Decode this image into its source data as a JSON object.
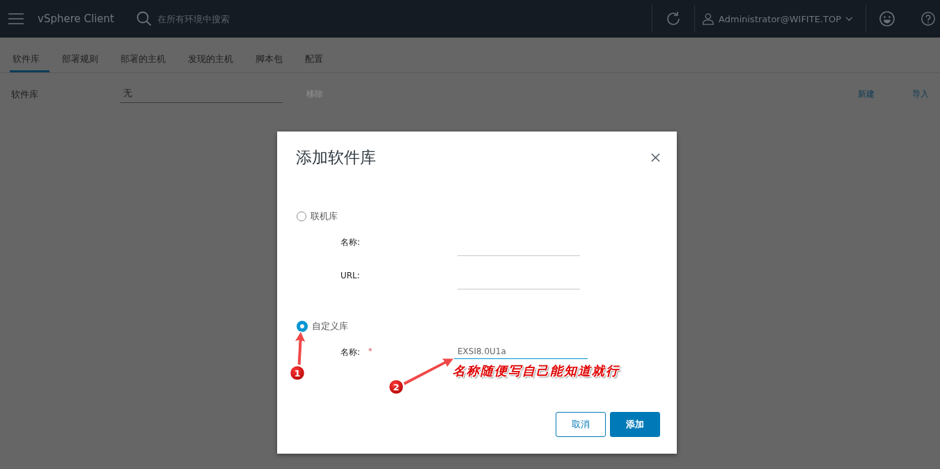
{
  "header": {
    "title": "vSphere Client",
    "search": {
      "placeholder": "在所有环境中搜索"
    },
    "user": "Administrator@WIFITE.TOP"
  },
  "tabs": [
    {
      "label": "软件库",
      "selected": true
    },
    {
      "label": "部署规则",
      "selected": false
    },
    {
      "label": "部署的主机",
      "selected": false
    },
    {
      "label": "发现的主机",
      "selected": false
    },
    {
      "label": "脚本包",
      "selected": false
    },
    {
      "label": "配置",
      "selected": false
    }
  ],
  "depot_row": {
    "label": "软件库",
    "value": "无",
    "remove": {
      "label": "移除",
      "disabled": true
    },
    "new": "新建",
    "import": "导入"
  },
  "dialog": {
    "title": "添加软件库",
    "options": [
      {
        "label": "联机库",
        "selected": false,
        "fields": [
          {
            "label": "名称:"
          },
          {
            "label": "URL:"
          }
        ]
      },
      {
        "label": "自定义库",
        "selected": true,
        "fields": [
          {
            "label": "名称:",
            "required_mark": "*",
            "value": "EXSI8.0U1a"
          }
        ]
      }
    ],
    "buttons": [
      {
        "label": "取消",
        "kind": "secondary"
      },
      {
        "label": "添加",
        "kind": "primary"
      }
    ]
  },
  "annotations": [
    {
      "number": "1"
    },
    {
      "number": "2",
      "note": "名称随便写自己能知道就行"
    }
  ]
}
